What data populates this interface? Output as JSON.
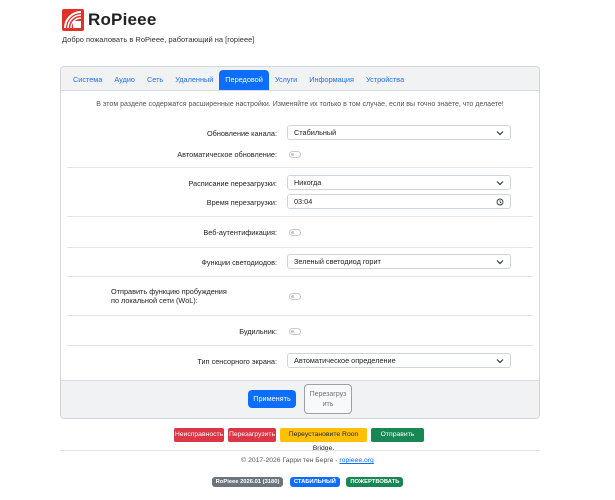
{
  "header": {
    "app_title": "RoPieee",
    "welcome": "Добро пожаловать в RoPieee, работающий на [ropieee]"
  },
  "tabs": [
    {
      "label": "Система",
      "active": false
    },
    {
      "label": "Аудио",
      "active": false
    },
    {
      "label": "Сеть",
      "active": false
    },
    {
      "label": "Удаленный",
      "active": false
    },
    {
      "label": "Передовой",
      "active": true
    },
    {
      "label": "Услуги",
      "active": false
    },
    {
      "label": "Информация",
      "active": false
    },
    {
      "label": "Устройства",
      "active": false
    }
  ],
  "notice": "В этом разделе содержатся расширенные настройки. Изменяйте их только в том случае, если вы точно знаете, что делаете!",
  "settings": {
    "update_channel": {
      "label": "Обновление канала:",
      "value": "Стабильный"
    },
    "auto_update": {
      "label": "Автоматическое обновление:",
      "enabled": false
    },
    "reboot_schedule": {
      "label": "Расписание перезагрузки:",
      "value": "Никогда"
    },
    "reboot_time": {
      "label": "Время перезагрузки:",
      "value": "03:04"
    },
    "web_auth": {
      "label": "Веб-аутентификация:",
      "enabled": false
    },
    "led_function": {
      "label": "Функции светодиодов:",
      "value": "Зеленый светодиод горит"
    },
    "wol": {
      "label_line1": "Отправить функцию пробуждения",
      "label_line2": "по локальной сети (WoL):",
      "enabled": false
    },
    "alarm": {
      "label": "Будильник:",
      "enabled": false
    },
    "touch_screen": {
      "label": "Тип сенсорного экрана:",
      "value": "Автоматическое определение"
    }
  },
  "footer_buttons": {
    "apply": "Применять",
    "reboot_line1": "Перезагруз",
    "reboot_line2": "ить"
  },
  "actions": {
    "broken": "Неисправность",
    "restart": "Перезагрузить",
    "reinstall_roon": "Переустановите Roon Bridge.",
    "feedback": "Отправить отзыв"
  },
  "copyright": {
    "text": "© 2017-2026 Гарри тен Берге - ",
    "link": "ropieee.org"
  },
  "badges": {
    "version": "RoPieee 2026.01 (3180)",
    "channel": "СТАБИЛЬНЫЙ",
    "donate": "ПОЖЕРТВОВАТЬ"
  },
  "colors": {
    "primary": "#0d6efd",
    "danger": "#dc3545",
    "warning": "#ffc107",
    "success": "#198754",
    "secondary": "#6c757d"
  }
}
